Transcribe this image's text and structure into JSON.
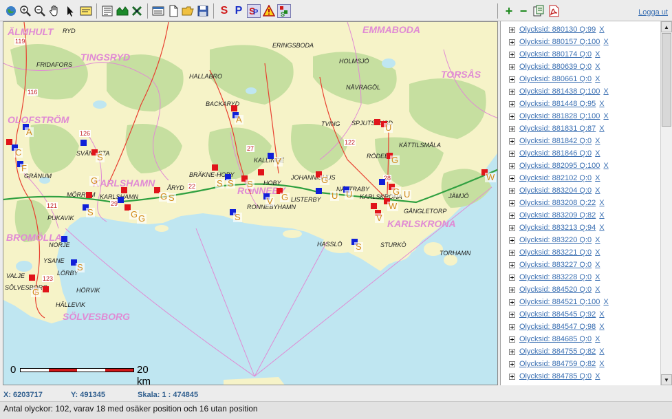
{
  "toolbar": {
    "logout_label": "Logga ut",
    "tools": [
      {
        "name": "globe-icon"
      },
      {
        "name": "zoom-in-icon"
      },
      {
        "name": "zoom-out-icon"
      },
      {
        "name": "pan-hand-icon"
      },
      {
        "name": "pointer-icon"
      },
      {
        "name": "info-box-icon"
      },
      {
        "name": "legend-icon"
      },
      {
        "name": "layers-icon"
      },
      {
        "name": "tools-icon"
      },
      {
        "name": "report-icon"
      },
      {
        "name": "new-document-icon"
      },
      {
        "name": "open-folder-icon"
      },
      {
        "name": "save-icon"
      },
      {
        "name": "s-tool-icon",
        "glyph": "S",
        "color": "#d01818"
      },
      {
        "name": "p-tool-icon",
        "glyph": "P",
        "color": "#1a2fc8"
      },
      {
        "name": "sp-tool-icon"
      },
      {
        "name": "warning-icon"
      },
      {
        "name": "statistics-icon"
      },
      {
        "name": "zoom-plus-icon",
        "glyph": "+",
        "color": "#1f8a1f"
      },
      {
        "name": "zoom-minus-icon",
        "glyph": "−",
        "color": "#1f8a1f"
      },
      {
        "name": "export-icon"
      },
      {
        "name": "pdf-icon"
      }
    ]
  },
  "map": {
    "regions": [
      "ÄLMHULT",
      "TINGSRYD",
      "EMMABODA",
      "TORSÅS",
      "OLOFSTRÖM",
      "KARLSHAMN",
      "RONNEBY",
      "KARLSKRONA",
      "BROMÖLLA",
      "SÖLVESBORG"
    ],
    "places": [
      "RYD",
      "ERINGSBODA",
      "FRIDAFORS",
      "HOLMSJÖ",
      "HALLABRO",
      "NÄVRAGÖL",
      "BACKARYD",
      "TVING",
      "SPJUTSBYGD",
      "SVÄNGSTA",
      "KÄTTILSMÅLA",
      "KALLINGE",
      "RÖDEBY",
      "GRÄNUM",
      "BRÄKNE-HOBY",
      "JOHANNISHUS",
      "MÖRRUM",
      "ÅRYD",
      "NÄTTRABY",
      "KARLSHAMN",
      "HOBY",
      "JÄMJÖ",
      "LISTERBY",
      "KARLSKRONA",
      "GÅNGLETORP",
      "PUKAVIK",
      "RONNEBYHAMN",
      "HASSLÖ",
      "STURKÖ",
      "NORJE",
      "TORHAMN",
      "YSANE",
      "LÖRBY",
      "VALJE",
      "SÖLVESBORG",
      "HÖRVIK",
      "HÄLLEVIK"
    ],
    "roads": [
      "119",
      "116",
      "126",
      "27",
      "122",
      "28",
      "29",
      "22",
      "121",
      "123"
    ],
    "marker_letters": [
      "A",
      "C",
      "F",
      "S",
      "G",
      "A",
      "S",
      "G",
      "S",
      "G",
      "S",
      "U",
      "G",
      "V",
      "G",
      "U",
      "U",
      "G",
      "V",
      "S",
      "S",
      "S",
      "S",
      "W",
      "W",
      "G",
      "U",
      "V",
      "G",
      "S",
      "G"
    ],
    "scalebar": {
      "start": "0",
      "end": "20 km"
    }
  },
  "list": {
    "items": [
      {
        "label": "Olycksid: 880130 Q:99"
      },
      {
        "label": "Olycksid: 880157 Q:100"
      },
      {
        "label": "Olycksid: 880174 Q:0"
      },
      {
        "label": "Olycksid: 880639 Q:0"
      },
      {
        "label": "Olycksid: 880661 Q:0"
      },
      {
        "label": "Olycksid: 881438 Q:100"
      },
      {
        "label": "Olycksid: 881448 Q:95"
      },
      {
        "label": "Olycksid: 881828 Q:100"
      },
      {
        "label": "Olycksid: 881831 Q:87"
      },
      {
        "label": "Olycksid: 881842 Q:0"
      },
      {
        "label": "Olycksid: 881846 Q:0"
      },
      {
        "label": "Olycksid: 882095 Q:100"
      },
      {
        "label": "Olycksid: 882102 Q:0"
      },
      {
        "label": "Olycksid: 883204 Q:0"
      },
      {
        "label": "Olycksid: 883208 Q:22"
      },
      {
        "label": "Olycksid: 883209 Q:82"
      },
      {
        "label": "Olycksid: 883213 Q:94"
      },
      {
        "label": "Olycksid: 883220 Q:0"
      },
      {
        "label": "Olycksid: 883221 Q:0"
      },
      {
        "label": "Olycksid: 883227 Q:0"
      },
      {
        "label": "Olycksid: 883228 Q:0"
      },
      {
        "label": "Olycksid: 884520 Q:0"
      },
      {
        "label": "Olycksid: 884521 Q:100"
      },
      {
        "label": "Olycksid: 884545 Q:92"
      },
      {
        "label": "Olycksid: 884547 Q:98"
      },
      {
        "label": "Olycksid: 884685 Q:0"
      },
      {
        "label": "Olycksid: 884755 Q:82"
      },
      {
        "label": "Olycksid: 884759 Q:82"
      },
      {
        "label": "Olycksid: 884785 Q:0"
      }
    ],
    "remove_label": "X"
  },
  "status": {
    "x_label": "X: 6203717",
    "y_label": "Y: 491345",
    "scale_label": "Skala: 1 : 474845",
    "summary": "Antal olyckor: 102, varav 18 med osäker position och 16 utan position"
  },
  "colors": {
    "water": "#bfe6f1",
    "land": "#f6f3c8",
    "forest": "#c6dfa0",
    "accent_link": "#3a6fb2",
    "marker_red": "#e0141a",
    "marker_blue": "#1020d8"
  }
}
